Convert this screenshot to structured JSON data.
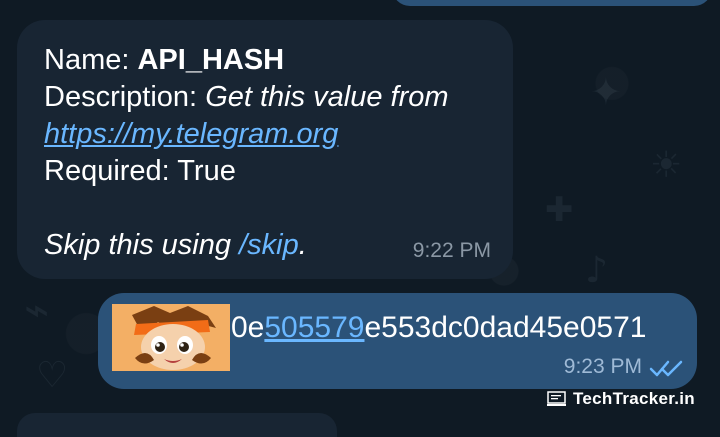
{
  "incoming_message": {
    "name_label": "Name:",
    "name_value": "API_HASH",
    "description_label": "Description:",
    "description_value": "Get this value from",
    "link_text": "https://my.telegram.org",
    "required_label": "Required:",
    "required_value": "True",
    "skip_prefix": "Skip this using",
    "skip_command": "/skip",
    "skip_suffix": ".",
    "time": "9:22 PM"
  },
  "outgoing_message": {
    "avatar_icon": "anime-boy-avatar-icon",
    "hash_prefix": "0e",
    "hash_link": "505579",
    "hash_suffix": "e553dc0dad45e0571",
    "time": "9:23 PM",
    "status_icon": "double-check-icon"
  },
  "watermark": {
    "text": "TechTracker.in",
    "icon": "laptop-icon"
  },
  "colors": {
    "chat_background": "#0f1a24",
    "incoming_bubble": "#182533",
    "outgoing_bubble": "#2b5278",
    "link": "#6ab7ff",
    "time_incoming": "#8b98a5",
    "time_outgoing": "#9fbad6",
    "text": "#ffffff"
  }
}
